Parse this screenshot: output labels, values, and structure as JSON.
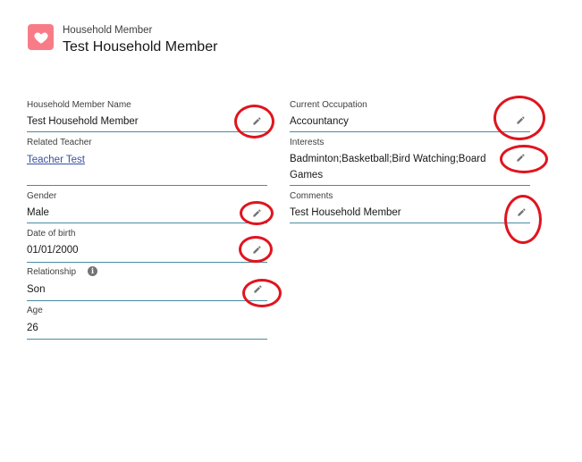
{
  "header": {
    "icon": "heart-icon",
    "icon_color": "#f87c88",
    "object_label": "Household Member",
    "record_title": "Test Household Member"
  },
  "fields": {
    "name": {
      "label": "Household Member Name",
      "value": "Test Household Member"
    },
    "teacher": {
      "label": "Related Teacher",
      "value": "Teacher Test"
    },
    "gender": {
      "label": "Gender",
      "value": "Male"
    },
    "dob": {
      "label": "Date of birth",
      "value": "01/01/2000"
    },
    "relationship": {
      "label": "Relationship",
      "value": "Son",
      "info_icon": "i"
    },
    "age": {
      "label": "Age",
      "value": "26"
    },
    "occupation": {
      "label": "Current Occupation",
      "value": "Accountancy"
    },
    "interests": {
      "label": "Interests",
      "value_line1": "Badminton;Basketball;Bird Watching;Board",
      "value_line2": "Games"
    },
    "comments": {
      "label": "Comments",
      "value": "Test Household Member"
    }
  },
  "colors": {
    "accent_line": "#4a8ba3",
    "link": "#3a4fa0",
    "annotation": "#e0141e"
  }
}
